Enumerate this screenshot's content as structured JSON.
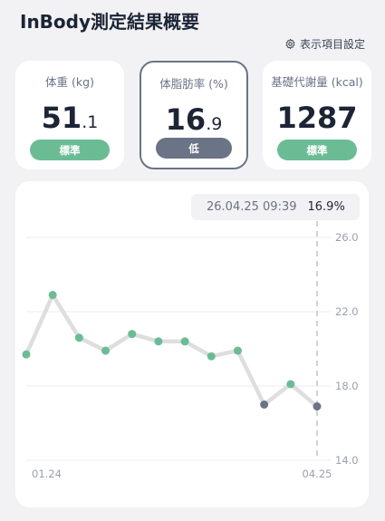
{
  "header": {
    "title": "InBody測定結果概要",
    "settings_label": "表示項目設定"
  },
  "cards": [
    {
      "label": "体重 (kg)",
      "value_int": "51",
      "value_dec": ".1",
      "status": "標準",
      "status_color": "#6bbc95",
      "selected": false
    },
    {
      "label": "体脂肪率 (%)",
      "value_int": "16",
      "value_dec": ".9",
      "status": "低",
      "status_color": "#6b7386",
      "selected": true
    },
    {
      "label": "基礎代謝量 (kcal)",
      "value_int": "1287",
      "value_dec": "",
      "status": "標準",
      "status_color": "#6bbc95",
      "selected": false
    }
  ],
  "tooltip": {
    "date": "26.04.25 09:39",
    "value": "16.9%"
  },
  "chart_data": {
    "type": "line",
    "y_ticks": [
      "26.0",
      "22.0",
      "18.0",
      "14.0"
    ],
    "ylim": [
      14,
      26
    ],
    "x_tick_labels": [
      "01.24",
      "04.25"
    ],
    "values": [
      19.7,
      22.9,
      20.6,
      19.9,
      20.8,
      20.4,
      20.4,
      19.6,
      19.9,
      17.0,
      18.1,
      16.9
    ],
    "point_status": [
      "normal",
      "normal",
      "normal",
      "normal",
      "normal",
      "normal",
      "normal",
      "normal",
      "normal",
      "low",
      "normal",
      "low"
    ],
    "colors": {
      "normal": "#6bbc95",
      "low": "#6b7386",
      "line": "#dedede"
    }
  }
}
